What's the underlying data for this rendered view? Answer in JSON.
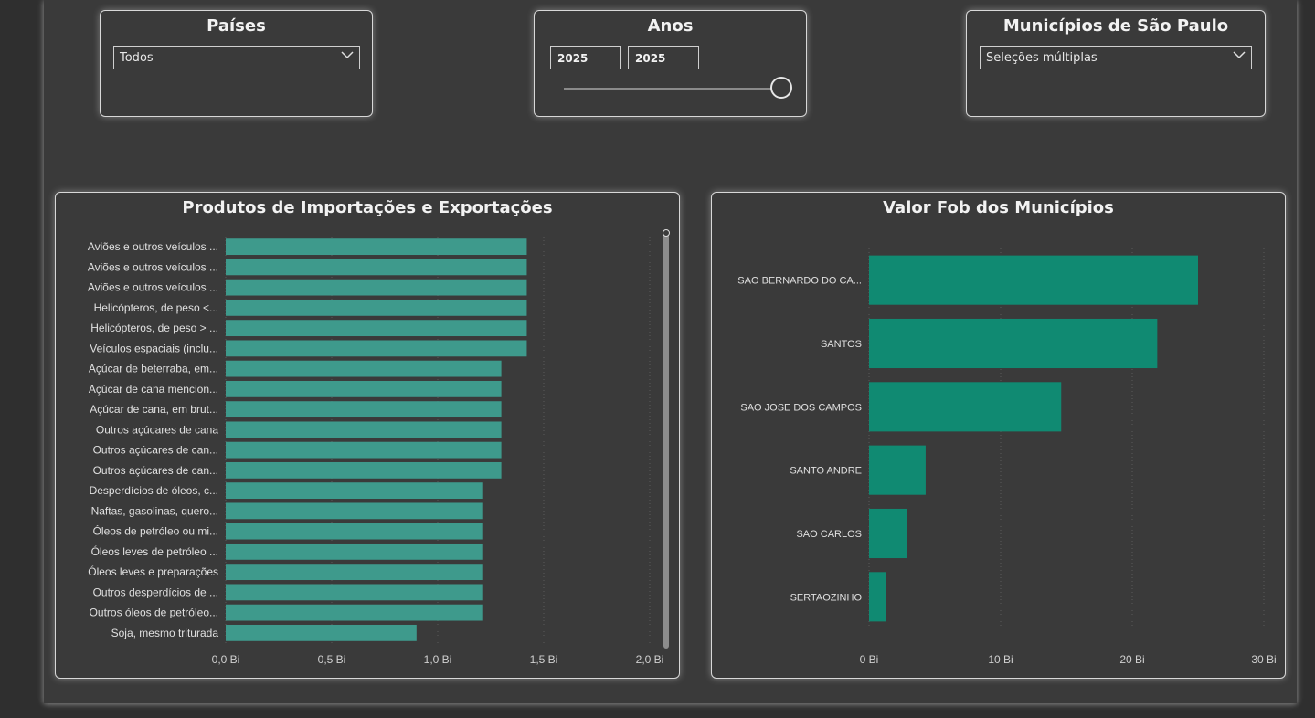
{
  "slicers": {
    "countries": {
      "title": "Países",
      "selected": "Todos"
    },
    "years": {
      "title": "Anos",
      "start": "2025",
      "end": "2025"
    },
    "municipalities": {
      "title": "Municípios de São Paulo",
      "selected": "Seleções múltiplas"
    }
  },
  "chart_data": [
    {
      "type": "bar",
      "orientation": "horizontal",
      "title": "Produtos de Importações e Exportações",
      "categories": [
        "Aviões e outros veículos ...",
        "Aviões e outros veículos ...",
        "Aviões e outros veículos ...",
        "Helicópteros, de peso <...",
        "Helicópteros, de peso > ...",
        "Veículos espaciais (inclu...",
        "Açúcar de beterraba, em...",
        "Açúcar de cana mencion...",
        "Açúcar de cana, em brut...",
        "Outros açúcares de cana",
        "Outros açúcares de can...",
        "Outros açúcares de can...",
        "Desperdícios de óleos, c...",
        "Naftas, gasolinas, quero...",
        "Óleos de petróleo ou mi...",
        "Óleos leves de petróleo ...",
        "Óleos leves e preparações",
        "Outros desperdícios de ...",
        "Outros óleos de petróleo...",
        "Soja, mesmo triturada"
      ],
      "values": [
        1.42,
        1.42,
        1.42,
        1.42,
        1.42,
        1.42,
        1.3,
        1.3,
        1.3,
        1.3,
        1.3,
        1.3,
        1.21,
        1.21,
        1.21,
        1.21,
        1.21,
        1.21,
        1.21,
        0.9
      ],
      "xlim": [
        0,
        2.0
      ],
      "xticks": [
        "0,0 Bi",
        "0,5 Bi",
        "1,0 Bi",
        "1,5 Bi",
        "2,0 Bi"
      ],
      "grid": true,
      "color": "#3e9a8c"
    },
    {
      "type": "bar",
      "orientation": "horizontal",
      "title": "Valor Fob dos Municípios",
      "categories": [
        "SAO BERNARDO DO CA...",
        "SANTOS",
        "SAO JOSE DOS CAMPOS",
        "SANTO ANDRE",
        "SAO CARLOS",
        "SERTAOZINHO"
      ],
      "values": [
        25.0,
        21.9,
        14.6,
        4.3,
        2.9,
        1.3
      ],
      "xlim": [
        0,
        30
      ],
      "xticks": [
        "0 Bi",
        "10 Bi",
        "20 Bi",
        "30 Bi"
      ],
      "grid": true,
      "color": "#108a72"
    }
  ]
}
